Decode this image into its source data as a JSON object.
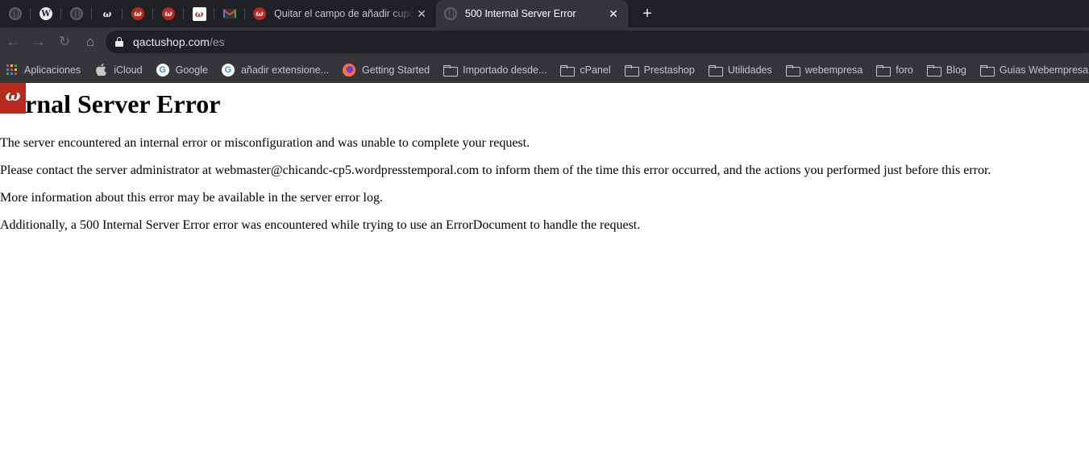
{
  "browser": {
    "pinned_tabs": [
      {
        "icon": "globe-icon",
        "glyph": ""
      },
      {
        "icon": "wordpress-icon",
        "glyph": "W"
      },
      {
        "icon": "globe-icon",
        "glyph": ""
      },
      {
        "icon": "webempresa-dark-icon",
        "glyph": "ω"
      },
      {
        "icon": "webempresa-icon",
        "glyph": "ω"
      },
      {
        "icon": "webempresa-icon",
        "glyph": "ω"
      },
      {
        "icon": "webempresa-square-icon",
        "glyph": "ω"
      },
      {
        "icon": "gmail-icon",
        "glyph": "M"
      }
    ],
    "tabs": [
      {
        "title": "Quitar el campo de añadir cupón",
        "close": "✕",
        "icon": "webempresa-icon",
        "glyph": "ω",
        "active": false
      },
      {
        "title": "500 Internal Server Error",
        "close": "✕",
        "icon": "globe-icon",
        "glyph": "",
        "active": true
      }
    ],
    "new_tab": "+",
    "nav": {
      "back": "←",
      "forward": "→",
      "reload": "↻",
      "home": "⌂"
    },
    "address": {
      "host": "qactushop.com",
      "path": "/es"
    },
    "bookmarks": [
      {
        "label": "Aplicaciones",
        "icon": "apps-grid-icon"
      },
      {
        "label": "iCloud",
        "icon": "apple-icon"
      },
      {
        "label": "Google",
        "icon": "google-icon"
      },
      {
        "label": "añadir extensione...",
        "icon": "google-icon"
      },
      {
        "label": "Getting Started",
        "icon": "firefox-icon"
      },
      {
        "label": "Importado desde...",
        "icon": "folder-icon"
      },
      {
        "label": "cPanel",
        "icon": "folder-icon"
      },
      {
        "label": "Prestashop",
        "icon": "folder-icon"
      },
      {
        "label": "Utilidades",
        "icon": "folder-icon"
      },
      {
        "label": "webempresa",
        "icon": "folder-icon"
      },
      {
        "label": "foro",
        "icon": "folder-icon"
      },
      {
        "label": "Blog",
        "icon": "folder-icon"
      },
      {
        "label": "Guias Webempresa",
        "icon": "folder-icon"
      }
    ],
    "colors": {
      "tabstrip": "#202124",
      "toolbar": "#35363a",
      "webempresa_red": "#b62a20"
    }
  },
  "page": {
    "badge_glyph": "ω",
    "heading": "Internal Server Error",
    "paragraphs": [
      "The server encountered an internal error or misconfiguration and was unable to complete your request.",
      "Please contact the server administrator at webmaster@chicandc-cp5.wordpresstemporal.com to inform them of the time this error occurred, and the actions you performed just before this error.",
      "More information about this error may be available in the server error log.",
      "Additionally, a 500 Internal Server Error error was encountered while trying to use an ErrorDocument to handle the request."
    ]
  }
}
